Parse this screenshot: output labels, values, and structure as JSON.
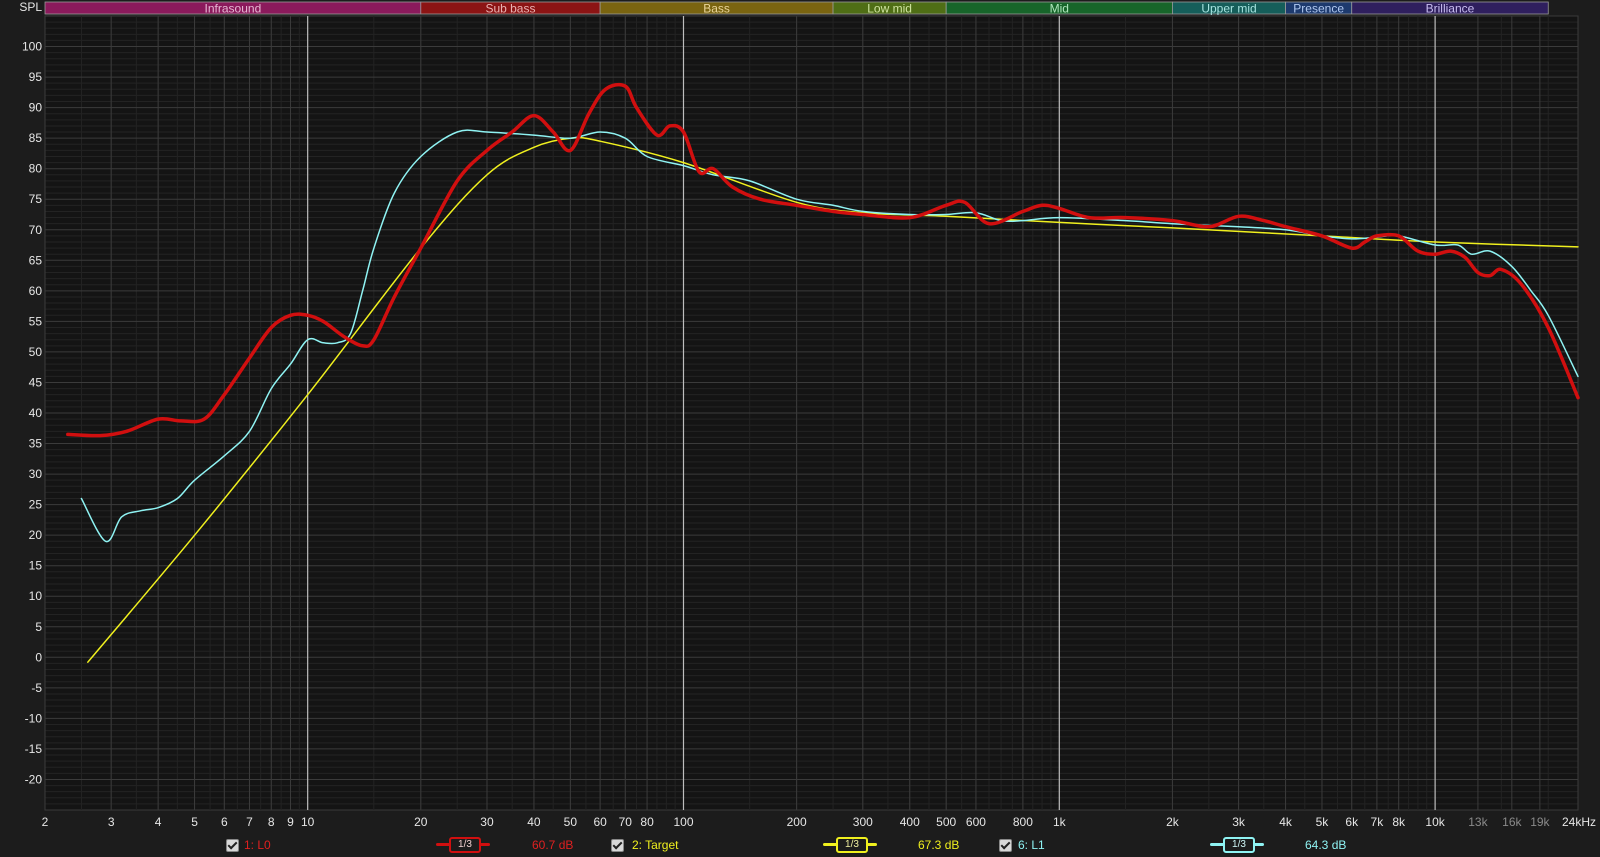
{
  "chart_data": {
    "type": "line",
    "x_scale": "log",
    "xlim": [
      2,
      24000
    ],
    "ylim": [
      -25,
      105
    ],
    "ylabel": "SPL",
    "yticks": [
      -20,
      -15,
      -10,
      -5,
      0,
      5,
      10,
      15,
      20,
      25,
      30,
      35,
      40,
      45,
      50,
      55,
      60,
      65,
      70,
      75,
      80,
      85,
      90,
      95,
      100
    ],
    "xticks": [
      {
        "value": 2,
        "label": "2"
      },
      {
        "value": 3,
        "label": "3"
      },
      {
        "value": 4,
        "label": "4"
      },
      {
        "value": 5,
        "label": "5"
      },
      {
        "value": 6,
        "label": "6"
      },
      {
        "value": 7,
        "label": "7"
      },
      {
        "value": 8,
        "label": "8"
      },
      {
        "value": 9,
        "label": "9"
      },
      {
        "value": 10,
        "label": "10"
      },
      {
        "value": 20,
        "label": "20"
      },
      {
        "value": 30,
        "label": "30"
      },
      {
        "value": 40,
        "label": "40"
      },
      {
        "value": 50,
        "label": "50"
      },
      {
        "value": 60,
        "label": "60"
      },
      {
        "value": 70,
        "label": "70"
      },
      {
        "value": 80,
        "label": "80"
      },
      {
        "value": 100,
        "label": "100"
      },
      {
        "value": 200,
        "label": "200"
      },
      {
        "value": 300,
        "label": "300"
      },
      {
        "value": 400,
        "label": "400"
      },
      {
        "value": 500,
        "label": "500"
      },
      {
        "value": 600,
        "label": "600"
      },
      {
        "value": 800,
        "label": "800"
      },
      {
        "value": 1000,
        "label": "1k"
      },
      {
        "value": 2000,
        "label": "2k"
      },
      {
        "value": 3000,
        "label": "3k"
      },
      {
        "value": 4000,
        "label": "4k"
      },
      {
        "value": 5000,
        "label": "5k"
      },
      {
        "value": 6000,
        "label": "6k"
      },
      {
        "value": 7000,
        "label": "7k"
      },
      {
        "value": 8000,
        "label": "8k"
      },
      {
        "value": 10000,
        "label": "10k"
      },
      {
        "value": 13000,
        "label": "13k",
        "dim": true
      },
      {
        "value": 16000,
        "label": "16k",
        "dim": true
      },
      {
        "value": 19000,
        "label": "19k",
        "dim": true
      },
      {
        "value": 24000,
        "label": "24kHz"
      }
    ],
    "bands": [
      {
        "name": "Infrasound",
        "from": 2,
        "to": 20,
        "color": "#8b1a5c",
        "text": "#e6b8d4"
      },
      {
        "name": "Sub bass",
        "from": 20,
        "to": 60,
        "color": "#8c1414",
        "text": "#eab3b3"
      },
      {
        "name": "Bass",
        "from": 60,
        "to": 250,
        "color": "#7a6410",
        "text": "#e9d59a"
      },
      {
        "name": "Low mid",
        "from": 250,
        "to": 500,
        "color": "#4f6e15",
        "text": "#cfe4a0"
      },
      {
        "name": "Mid",
        "from": 500,
        "to": 2000,
        "color": "#17652a",
        "text": "#aee6bb"
      },
      {
        "name": "Upper mid",
        "from": 2000,
        "to": 4000,
        "color": "#155e5a",
        "text": "#a6e3df"
      },
      {
        "name": "Presence",
        "from": 4000,
        "to": 6000,
        "color": "#1d3a6e",
        "text": "#b0c8f0"
      },
      {
        "name": "Brilliance",
        "from": 6000,
        "to": 20000,
        "color": "#2f1f5e",
        "text": "#c8bdf0"
      }
    ],
    "series": [
      {
        "name": "1: L0",
        "color": "#d10f0f",
        "width": 3.5,
        "smoothing": "1/3",
        "value_label": "60.7 dB",
        "x": [
          2.3,
          2.8,
          3.3,
          4,
          4.6,
          5.3,
          6,
          7,
          8,
          9,
          10,
          11,
          12.5,
          14,
          15,
          17,
          20,
          25,
          30,
          35,
          40,
          45,
          50,
          56,
          62,
          70,
          75,
          85,
          92,
          100,
          110,
          120,
          135,
          160,
          200,
          250,
          300,
          400,
          500,
          560,
          650,
          800,
          900,
          1000,
          1200,
          1500,
          2000,
          2500,
          3000,
          3500,
          4000,
          5000,
          6000,
          6500,
          7000,
          8000,
          9000,
          10000,
          11000,
          12000,
          13000,
          14000,
          15000,
          17000,
          20000,
          24000
        ],
        "y": [
          36.5,
          36.3,
          37,
          39,
          38.7,
          39,
          43,
          49,
          54,
          56,
          56,
          55,
          52.5,
          51,
          52,
          59,
          67,
          78,
          83,
          86,
          88.7,
          86,
          83,
          89,
          93,
          93.5,
          90,
          85.5,
          87,
          86,
          79.5,
          80,
          77,
          75,
          74,
          73,
          72.5,
          72,
          74,
          74.5,
          71,
          73,
          74,
          73.5,
          72,
          72,
          71.5,
          70.5,
          72.2,
          71.5,
          70.5,
          69,
          67,
          68,
          69,
          69,
          66.5,
          66,
          66.5,
          65.5,
          63,
          62.5,
          63.5,
          61,
          54,
          42.5
        ]
      },
      {
        "name": "2: Target",
        "color": "#f0f01e",
        "width": 1.5,
        "smoothing": "1/3",
        "value_label": "67.3 dB",
        "x": [
          2.6,
          5,
          10,
          20,
          30,
          40,
          50,
          60,
          100,
          200,
          300,
          500,
          1000,
          2000,
          5000,
          10000,
          24000
        ],
        "y": [
          -0.8,
          20,
          43,
          67,
          79,
          83.5,
          85,
          84.5,
          81,
          74.5,
          72.8,
          72.2,
          71.2,
          70.3,
          69,
          68,
          67.2
        ]
      },
      {
        "name": "6: L1",
        "color": "#8ff3f3",
        "width": 1.5,
        "smoothing": "1/3",
        "value_label": "64.3 dB",
        "x": [
          2.5,
          2.9,
          3.2,
          3.6,
          4,
          4.5,
          5,
          6,
          7,
          8,
          9,
          10,
          11,
          12,
          13,
          14,
          15,
          17,
          20,
          25,
          30,
          40,
          50,
          60,
          70,
          80,
          100,
          120,
          150,
          200,
          250,
          300,
          400,
          500,
          600,
          700,
          800,
          1000,
          1500,
          2000,
          3000,
          4000,
          5000,
          6000,
          7000,
          8000,
          10000,
          11500,
          12500,
          14000,
          16000,
          18000,
          20000,
          24000
        ],
        "y": [
          26,
          19,
          23,
          24,
          24.5,
          26,
          29,
          33,
          37,
          44,
          48,
          52,
          51.5,
          51.5,
          53,
          60,
          67,
          76,
          82,
          86,
          86,
          85.5,
          85,
          86,
          85,
          82,
          80.5,
          79,
          78,
          75,
          74,
          73,
          72.5,
          72.5,
          72.8,
          71.5,
          71.5,
          72,
          71.5,
          71,
          70.5,
          70,
          69,
          68.5,
          68.8,
          69,
          67.5,
          67.5,
          66,
          66.5,
          64,
          60,
          56,
          46
        ]
      }
    ]
  },
  "legend": {
    "items": [
      {
        "label": "1: L0",
        "smoothing": "1/3",
        "value": "60.7 dB"
      },
      {
        "label": "2: Target",
        "smoothing": "1/3",
        "value": "67.3 dB"
      },
      {
        "label": "6: L1",
        "smoothing": "1/3",
        "value": "64.3 dB"
      }
    ]
  }
}
